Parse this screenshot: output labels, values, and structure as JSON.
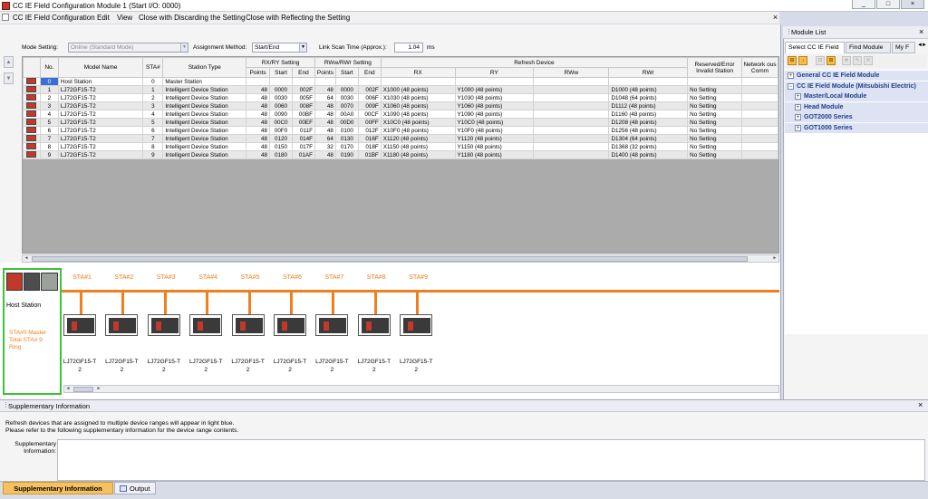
{
  "window": {
    "title": "CC IE Field Configuration Module 1 (Start I/O: 0000)",
    "minimize": "_",
    "maximize": "□",
    "close": "×"
  },
  "menu": {
    "items": [
      "CC IE Field Configuration",
      "Edit",
      "View",
      "Close with Discarding the Setting",
      "Close with Reflecting the Setting"
    ],
    "close": "×"
  },
  "settings": {
    "mode_label": "Mode Setting:",
    "mode_value": "Online (Standard Mode)",
    "assign_label": "Assignment Method:",
    "assign_value": "Start/End",
    "scan_label": "Link Scan Time (Approx.):",
    "scan_value": "1.04",
    "scan_unit": "ms"
  },
  "grid": {
    "headers": {
      "no": "No.",
      "model": "Model Name",
      "sta": "STA#",
      "type": "Station Type",
      "rxry": "RX/RY Setting",
      "rwwrwr": "RWw/RWr Setting",
      "refresh": "Refresh Device",
      "reserved": "Reserved/Error Invalid Station",
      "network": "Network ous Comm",
      "points": "Points",
      "start": "Start",
      "end": "End",
      "rx": "RX",
      "ry": "RY",
      "rww": "RWw",
      "rwr": "RWr"
    },
    "rows": [
      {
        "no": "0",
        "model": "Host Station",
        "sta": "0",
        "type": "Master Station",
        "p1": "",
        "s1": "",
        "e1": "",
        "p2": "",
        "s2": "",
        "e2": "",
        "rx": "",
        "ry": "",
        "rww": "",
        "rwr": "",
        "res": ""
      },
      {
        "no": "1",
        "model": "LJ72GF15-T2",
        "sta": "1",
        "type": "Intelligent Device Station",
        "p1": "48",
        "s1": "0000",
        "e1": "002F",
        "p2": "48",
        "s2": "0000",
        "e2": "002F",
        "rx": "X1000 (48 points)",
        "ry": "Y1000 (48 points)",
        "rww": "",
        "rwr": "D1000 (48 points)",
        "res": "No Setting"
      },
      {
        "no": "2",
        "model": "LJ72GF15-T2",
        "sta": "2",
        "type": "Intelligent Device Station",
        "p1": "48",
        "s1": "0030",
        "e1": "005F",
        "p2": "64",
        "s2": "0030",
        "e2": "006F",
        "rx": "X1030 (48 points)",
        "ry": "Y1030 (48 points)",
        "rww": "",
        "rwr": "D1048 (64 points)",
        "res": "No Setting"
      },
      {
        "no": "3",
        "model": "LJ72GF15-T2",
        "sta": "3",
        "type": "Intelligent Device Station",
        "p1": "48",
        "s1": "0060",
        "e1": "008F",
        "p2": "48",
        "s2": "0070",
        "e2": "009F",
        "rx": "X1060 (48 points)",
        "ry": "Y1060 (48 points)",
        "rww": "",
        "rwr": "D1112 (48 points)",
        "res": "No Setting"
      },
      {
        "no": "4",
        "model": "LJ72GF15-T2",
        "sta": "4",
        "type": "Intelligent Device Station",
        "p1": "48",
        "s1": "0090",
        "e1": "00BF",
        "p2": "48",
        "s2": "00A0",
        "e2": "00CF",
        "rx": "X1090 (48 points)",
        "ry": "Y1090 (48 points)",
        "rww": "",
        "rwr": "D1160 (48 points)",
        "res": "No Setting"
      },
      {
        "no": "5",
        "model": "LJ72GF15-T2",
        "sta": "5",
        "type": "Intelligent Device Station",
        "p1": "48",
        "s1": "00C0",
        "e1": "00EF",
        "p2": "48",
        "s2": "00D0",
        "e2": "00FF",
        "rx": "X10C0 (48 points)",
        "ry": "Y10C0 (48 points)",
        "rww": "",
        "rwr": "D1208 (48 points)",
        "res": "No Setting"
      },
      {
        "no": "6",
        "model": "LJ72GF15-T2",
        "sta": "6",
        "type": "Intelligent Device Station",
        "p1": "48",
        "s1": "00F0",
        "e1": "011F",
        "p2": "48",
        "s2": "0100",
        "e2": "012F",
        "rx": "X10F0 (48 points)",
        "ry": "Y10F0 (48 points)",
        "rww": "",
        "rwr": "D1256 (48 points)",
        "res": "No Setting"
      },
      {
        "no": "7",
        "model": "LJ72GF15-T2",
        "sta": "7",
        "type": "Intelligent Device Station",
        "p1": "48",
        "s1": "0120",
        "e1": "014F",
        "p2": "64",
        "s2": "0130",
        "e2": "016F",
        "rx": "X1120 (48 points)",
        "ry": "Y1120 (48 points)",
        "rww": "",
        "rwr": "D1304 (64 points)",
        "res": "No Setting"
      },
      {
        "no": "8",
        "model": "LJ72GF15-T2",
        "sta": "8",
        "type": "Intelligent Device Station",
        "p1": "48",
        "s1": "0150",
        "e1": "017F",
        "p2": "32",
        "s2": "0170",
        "e2": "018F",
        "rx": "X1150 (48 points)",
        "ry": "Y1150 (48 points)",
        "rww": "",
        "rwr": "D1368 (32 points)",
        "res": "No Setting"
      },
      {
        "no": "9",
        "model": "LJ72GF15-T2",
        "sta": "9",
        "type": "Intelligent Device Station",
        "p1": "48",
        "s1": "0180",
        "e1": "01AF",
        "p2": "48",
        "s2": "0190",
        "e2": "01BF",
        "rx": "X1180 (48 points)",
        "ry": "Y1180 (48 points)",
        "rww": "",
        "rwr": "D1400 (48 points)",
        "res": "No Setting"
      }
    ]
  },
  "diagram": {
    "host_label": "Host Station",
    "host_info_1": "STA#0  Master",
    "host_info_2": "Total STA# 9",
    "host_info_3": "Ring",
    "stations": [
      {
        "label": "STA#1",
        "model_a": "LJ72GF15-T",
        "model_b": "2"
      },
      {
        "label": "STA#2",
        "model_a": "LJ72GF15-T",
        "model_b": "2"
      },
      {
        "label": "STA#3",
        "model_a": "LJ72GF15-T",
        "model_b": "2"
      },
      {
        "label": "STA#4",
        "model_a": "LJ72GF15-T",
        "model_b": "2"
      },
      {
        "label": "STA#5",
        "model_a": "LJ72GF15-T",
        "model_b": "2"
      },
      {
        "label": "STA#6",
        "model_a": "LJ72GF15-T",
        "model_b": "2"
      },
      {
        "label": "STA#7",
        "model_a": "LJ72GF15-T",
        "model_b": "2"
      },
      {
        "label": "STA#8",
        "model_a": "LJ72GF15-T",
        "model_b": "2"
      },
      {
        "label": "STA#9",
        "model_a": "LJ72GF15-T",
        "model_b": "2"
      }
    ]
  },
  "module_list": {
    "title": "Module List",
    "close": "×",
    "tabs": [
      "Select CC IE Field",
      "Find Module",
      "My F"
    ],
    "tree": [
      "General CC IE Field Module",
      "CC IE Field Module (Mitsubishi Electric)",
      "Master/Local Module",
      "Head Module",
      "GOT2000 Series",
      "GOT1000 Series"
    ]
  },
  "supplementary": {
    "title": "Supplementary Information",
    "close": "×",
    "line1": "Refresh devices that are assigned to multiple device ranges will appear in light blue.",
    "line2": "Please refer to the following supplementary information for the device range contents.",
    "label_a": "Supplementary",
    "label_b": "Information:"
  },
  "bottom_tabs": {
    "active": "Supplementary Information",
    "output": "Output"
  },
  "colors": {
    "accent_orange": "#f07f1e",
    "host_border": "#3cc23c",
    "tree_text": "#1e3e8c"
  }
}
